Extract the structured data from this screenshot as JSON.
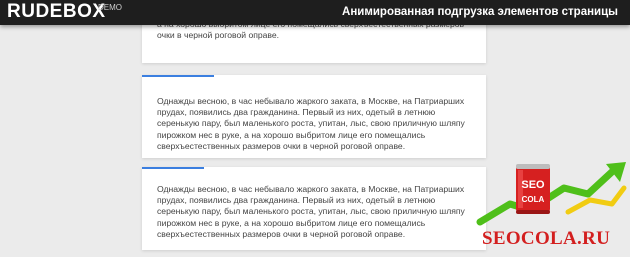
{
  "header": {
    "logo_part1": "RUDE",
    "logo_part2": "BOX",
    "demo_label": "DEMO",
    "title": "Анимированная подгрузка элементов страницы"
  },
  "cards": [
    {
      "text": "маленького роста, упитан, лыс, свою приличную шляпу пирожком нес в руке, а на хорошо выбритом лице его помещались сверхъестественных размеров очки в черной роговой оправе.",
      "progress": 0
    },
    {
      "text": "Однажды весною, в час небывало жаркого заката, в Москве, на Патриарших прудах, появились два гражданина. Первый из них, одетый в летнюю серенькую пару, был маленького роста, упитан, лыс, свою приличную шляпу пирожком нес в руке, а на хорошо выбритом лице его помещались сверхъестественных размеров очки в черной роговой оправе.",
      "progress": 0.21
    },
    {
      "text": "Однажды весною, в час небывало жаркого заката, в Москве, на Патриарших прудах, появились два гражданина. Первый из них, одетый в летнюю серенькую пару, был маленького роста, упитан, лыс, свою приличную шляпу пирожком нес в руке, а на хорошо выбритом лице его помещались сверхъестественных размеров очки в черной роговой оправе.",
      "progress": 0.18
    }
  ],
  "watermark": {
    "can_top": "SEO",
    "can_bottom": "COLA",
    "url": "SEOCOLA.RU"
  },
  "colors": {
    "header_bg": "#1e1e1e",
    "page_bg": "#ebebeb",
    "progress_bar": "#3b7fe0",
    "watermark_red": "#d31f1f"
  }
}
